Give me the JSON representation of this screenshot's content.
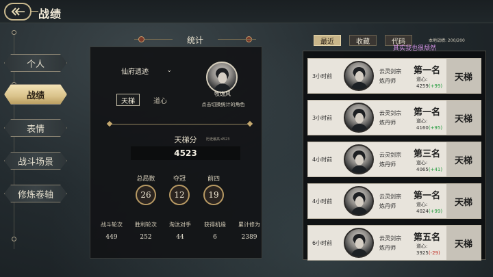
{
  "header": {
    "title": "战绩"
  },
  "sidebar": {
    "items": [
      {
        "label": "个人",
        "active": false
      },
      {
        "label": "战绩",
        "active": true
      },
      {
        "label": "表情",
        "active": false
      },
      {
        "label": "战斗场景",
        "active": false
      },
      {
        "label": "修炼卷轴",
        "active": false
      }
    ]
  },
  "stats": {
    "title": "统计",
    "select_value": "仙府遗迹",
    "tabs": [
      "天梯",
      "道心"
    ],
    "character_name": "牧逸风",
    "character_hint": "点击切换统计的角色",
    "ladder": {
      "label": "天梯分",
      "history_note": "历史最高:4523",
      "score": "4523"
    },
    "circles": [
      {
        "label": "总局数",
        "value": "26"
      },
      {
        "label": "夺冠",
        "value": "12"
      },
      {
        "label": "前四",
        "value": "19"
      }
    ],
    "bottom": [
      {
        "label": "战斗轮次",
        "value": "449"
      },
      {
        "label": "胜利轮次",
        "value": "252"
      },
      {
        "label": "淘汰对手",
        "value": "44"
      },
      {
        "label": "获得机缘",
        "value": "6"
      },
      {
        "label": "累计修为",
        "value": "2389"
      }
    ]
  },
  "records_panel": {
    "buttons": [
      "最近",
      "收藏",
      "代码"
    ],
    "local_count": "本地战绩: 200/200",
    "note": "其实我也很颓然",
    "records": [
      {
        "time": "3小时前",
        "sect": "云灵剑宗",
        "role": "炼丹师",
        "rank": "第一名",
        "dao_label": "道心:",
        "dao_value": "4259",
        "delta": "(+99)",
        "delta_type": "up",
        "mode": "天梯"
      },
      {
        "time": "3小时前",
        "sect": "云灵剑宗",
        "role": "炼丹师",
        "rank": "第一名",
        "dao_label": "道心:",
        "dao_value": "4160",
        "delta": "(+95)",
        "delta_type": "up",
        "mode": "天梯"
      },
      {
        "time": "4小时前",
        "sect": "云灵剑宗",
        "role": "炼丹师",
        "rank": "第三名",
        "dao_label": "道心:",
        "dao_value": "4065",
        "delta": "(+41)",
        "delta_type": "up",
        "mode": "天梯"
      },
      {
        "time": "4小时前",
        "sect": "云灵剑宗",
        "role": "炼丹师",
        "rank": "第一名",
        "dao_label": "道心:",
        "dao_value": "4024",
        "delta": "(+99)",
        "delta_type": "up",
        "mode": "天梯"
      },
      {
        "time": "6小时前",
        "sect": "云灵剑宗",
        "role": "炼丹师",
        "rank": "第五名",
        "dao_label": "道心:",
        "dao_value": "3925",
        "delta": "(-29)",
        "delta_type": "down",
        "mode": "天梯"
      }
    ]
  },
  "colors": {
    "gold": "#c9b98e",
    "up": "#1f9a3a",
    "down": "#c02a22",
    "card_bg": "#e8e4dc",
    "note": "#cf8fe0"
  }
}
